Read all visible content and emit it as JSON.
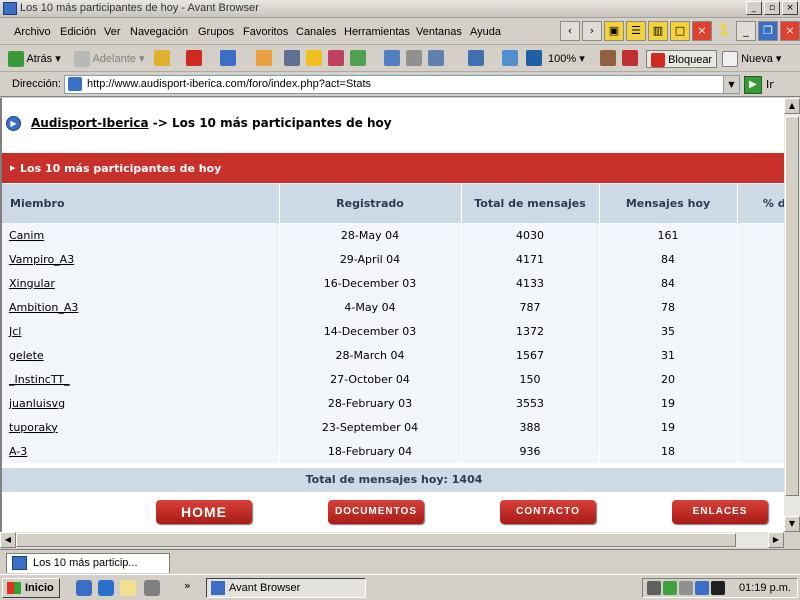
{
  "window": {
    "title": "Los 10 más participantes de hoy - Avant Browser"
  },
  "menu": [
    "Archivo",
    "Edición",
    "Ver",
    "Navegación",
    "Grupos",
    "Favoritos",
    "Canales",
    "Herramientas",
    "Ventanas",
    "Ayuda"
  ],
  "window_count": "1",
  "toolbar": {
    "back": "Atrás",
    "forward": "Adelante",
    "zoom": "100%",
    "block": "Bloquear",
    "new": "Nueva"
  },
  "address": {
    "label": "Dirección:",
    "url": "http://www.audisport-iberica.com/foro/index.php?act=Stats",
    "go": "Ir"
  },
  "page": {
    "breadcrumb_link": "Audisport-Iberica",
    "breadcrumb_rest": "-> Los 10 más participantes de hoy",
    "section_title": "Los 10 más participantes de hoy",
    "columns": [
      "Miembro",
      "Registrado",
      "Total de mensajes",
      "Mensajes hoy",
      "% d"
    ],
    "rows": [
      {
        "member": "Canim",
        "registered": "28-May 04",
        "total": "4030",
        "today": "161"
      },
      {
        "member": "Vampiro_A3",
        "registered": "29-April 04",
        "total": "4171",
        "today": "84"
      },
      {
        "member": "Xingular",
        "registered": "16-December 03",
        "total": "4133",
        "today": "84"
      },
      {
        "member": "Ambition_A3",
        "registered": "4-May 04",
        "total": "787",
        "today": "78"
      },
      {
        "member": "Jcl",
        "registered": "14-December 03",
        "total": "1372",
        "today": "35"
      },
      {
        "member": "gelete",
        "registered": "28-March 04",
        "total": "1567",
        "today": "31"
      },
      {
        "member": "_InstincTT_",
        "registered": "27-October 04",
        "total": "150",
        "today": "20"
      },
      {
        "member": "juanluisvg",
        "registered": "28-February 03",
        "total": "3553",
        "today": "19"
      },
      {
        "member": "tuporaky",
        "registered": "23-September 04",
        "total": "388",
        "today": "19"
      },
      {
        "member": "A-3",
        "registered": "18-February 04",
        "total": "936",
        "today": "18"
      }
    ],
    "total_label": "Total de mensajes hoy: 1404",
    "nav_buttons": [
      "HOME",
      "DOCUMENTOS",
      "CONTACTO",
      "ENLACES"
    ]
  },
  "tab": {
    "label": "Los 10 más particip..."
  },
  "taskbar": {
    "start": "Inicio",
    "task": "Avant Browser",
    "clock": "01:19 p.m."
  },
  "colors": {
    "red_bar": "#c8302c",
    "table_header": "#ced9e6",
    "header_text": "#2c3a52"
  }
}
